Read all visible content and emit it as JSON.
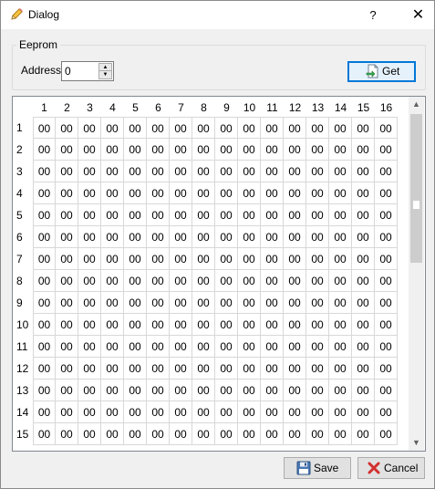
{
  "window": {
    "title": "Dialog",
    "help_glyph": "?",
    "close_glyph": "✕",
    "title_icon": "pencil-icon"
  },
  "eeprom": {
    "group_title": "Eeprom",
    "address_label": "Address",
    "address_value": "0",
    "get_label": "Get",
    "get_icon": "document-arrow-icon"
  },
  "table": {
    "columns": [
      "1",
      "2",
      "3",
      "4",
      "5",
      "6",
      "7",
      "8",
      "9",
      "10",
      "11",
      "12",
      "13",
      "14",
      "15",
      "16"
    ],
    "rows": [
      {
        "label": "1",
        "cells": [
          "00",
          "00",
          "00",
          "00",
          "00",
          "00",
          "00",
          "00",
          "00",
          "00",
          "00",
          "00",
          "00",
          "00",
          "00",
          "00"
        ]
      },
      {
        "label": "2",
        "cells": [
          "00",
          "00",
          "00",
          "00",
          "00",
          "00",
          "00",
          "00",
          "00",
          "00",
          "00",
          "00",
          "00",
          "00",
          "00",
          "00"
        ]
      },
      {
        "label": "3",
        "cells": [
          "00",
          "00",
          "00",
          "00",
          "00",
          "00",
          "00",
          "00",
          "00",
          "00",
          "00",
          "00",
          "00",
          "00",
          "00",
          "00"
        ]
      },
      {
        "label": "4",
        "cells": [
          "00",
          "00",
          "00",
          "00",
          "00",
          "00",
          "00",
          "00",
          "00",
          "00",
          "00",
          "00",
          "00",
          "00",
          "00",
          "00"
        ]
      },
      {
        "label": "5",
        "cells": [
          "00",
          "00",
          "00",
          "00",
          "00",
          "00",
          "00",
          "00",
          "00",
          "00",
          "00",
          "00",
          "00",
          "00",
          "00",
          "00"
        ]
      },
      {
        "label": "6",
        "cells": [
          "00",
          "00",
          "00",
          "00",
          "00",
          "00",
          "00",
          "00",
          "00",
          "00",
          "00",
          "00",
          "00",
          "00",
          "00",
          "00"
        ]
      },
      {
        "label": "7",
        "cells": [
          "00",
          "00",
          "00",
          "00",
          "00",
          "00",
          "00",
          "00",
          "00",
          "00",
          "00",
          "00",
          "00",
          "00",
          "00",
          "00"
        ]
      },
      {
        "label": "8",
        "cells": [
          "00",
          "00",
          "00",
          "00",
          "00",
          "00",
          "00",
          "00",
          "00",
          "00",
          "00",
          "00",
          "00",
          "00",
          "00",
          "00"
        ]
      },
      {
        "label": "9",
        "cells": [
          "00",
          "00",
          "00",
          "00",
          "00",
          "00",
          "00",
          "00",
          "00",
          "00",
          "00",
          "00",
          "00",
          "00",
          "00",
          "00"
        ]
      },
      {
        "label": "10",
        "cells": [
          "00",
          "00",
          "00",
          "00",
          "00",
          "00",
          "00",
          "00",
          "00",
          "00",
          "00",
          "00",
          "00",
          "00",
          "00",
          "00"
        ]
      },
      {
        "label": "11",
        "cells": [
          "00",
          "00",
          "00",
          "00",
          "00",
          "00",
          "00",
          "00",
          "00",
          "00",
          "00",
          "00",
          "00",
          "00",
          "00",
          "00"
        ]
      },
      {
        "label": "12",
        "cells": [
          "00",
          "00",
          "00",
          "00",
          "00",
          "00",
          "00",
          "00",
          "00",
          "00",
          "00",
          "00",
          "00",
          "00",
          "00",
          "00"
        ]
      },
      {
        "label": "13",
        "cells": [
          "00",
          "00",
          "00",
          "00",
          "00",
          "00",
          "00",
          "00",
          "00",
          "00",
          "00",
          "00",
          "00",
          "00",
          "00",
          "00"
        ]
      },
      {
        "label": "14",
        "cells": [
          "00",
          "00",
          "00",
          "00",
          "00",
          "00",
          "00",
          "00",
          "00",
          "00",
          "00",
          "00",
          "00",
          "00",
          "00",
          "00"
        ]
      },
      {
        "label": "15",
        "cells": [
          "00",
          "00",
          "00",
          "00",
          "00",
          "00",
          "00",
          "00",
          "00",
          "00",
          "00",
          "00",
          "00",
          "00",
          "00",
          "00"
        ]
      }
    ]
  },
  "buttons": {
    "save_label": "Save",
    "save_icon": "floppy-disk-icon",
    "cancel_label": "Cancel",
    "cancel_icon": "red-x-icon"
  },
  "colors": {
    "focus_border": "#0078d7",
    "focus_fill": "#e5f1fb",
    "cancel_x": "#d32f2f"
  }
}
